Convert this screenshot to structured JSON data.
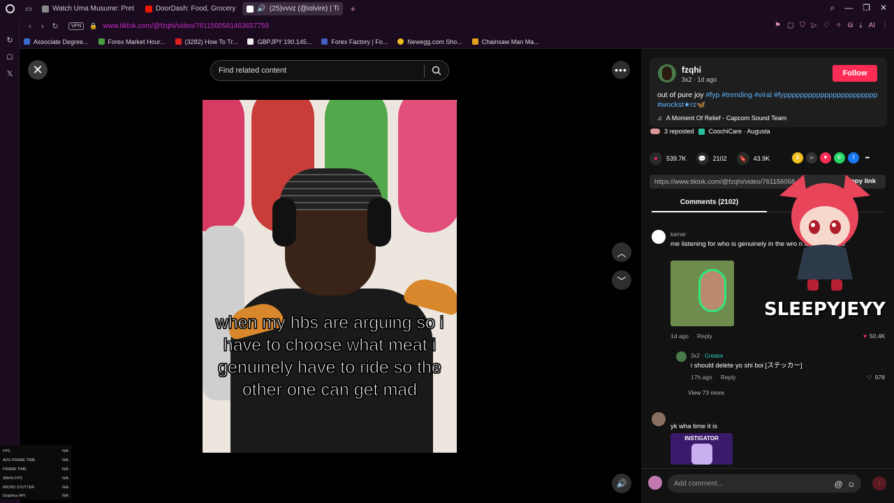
{
  "browser": {
    "tabs": [
      {
        "label": "Watch Uma Musume: Pret",
        "color": "#cccccc"
      },
      {
        "label": "DoorDash: Food, Grocery",
        "color": "#eb1700"
      },
      {
        "label": "(25)vvvz (@iolvire) | Ti",
        "color": "#ffffff",
        "active": true
      }
    ],
    "url": "www.tiktok.com/@fzqhi/video/7611560581463657759",
    "vpn_label": "VPN",
    "bookmarks": [
      {
        "label": "Associate Degree...",
        "color": "#3a6ad0"
      },
      {
        "label": "Forex Market Hour...",
        "color": "#48a040"
      },
      {
        "label": "(3282) How To Tr...",
        "color": "#e02020"
      },
      {
        "label": "GBPJPY 190.145...",
        "color": "#eeeeee"
      },
      {
        "label": "Forex Factory | Fo...",
        "color": "#4060c0"
      },
      {
        "label": "Newegg.com Sho...",
        "color": "#f0c020"
      },
      {
        "label": "Chainsaw Man Ma...",
        "color": "#e0a020"
      }
    ]
  },
  "search": {
    "placeholder": "Find related content"
  },
  "video": {
    "caption": "when my hbs are arguing so i have to choose what meat i genuinely have to ride so the other one can get mad"
  },
  "stats": [
    {
      "label": "FPS",
      "value": "N/A"
    },
    {
      "label": "AVG FRAME TIME",
      "value": "N/A"
    },
    {
      "label": "FRAME TIME",
      "value": "N/A"
    },
    {
      "label": "99th% FPS",
      "value": "N/A"
    },
    {
      "label": "MICRO STUTTER",
      "value": "N/A"
    },
    {
      "label": "Graphics API",
      "value": "N/A"
    }
  ],
  "post": {
    "username": "fzqhi",
    "meta": "3x2 · 1d ago",
    "follow_label": "Follow",
    "desc_text": "out of pure joy ",
    "tags": [
      "#fyp",
      "#trending",
      "#viral",
      "#fyppppppppppppppppppppppp",
      "#wockst★rz"
    ],
    "emoji": "🦋",
    "music": "A Moment Of Relief - Capcom Sound Team",
    "reposted": "3 reposted",
    "location": "CoochiCare · Augusta",
    "likes": "539.7K",
    "comments_count": "2102",
    "saves": "43.9K",
    "link": "https://www.tiktok.com/@fzqhi/video/761156058",
    "copy_link": "Copy link",
    "comments_tab": "Comments (2102)"
  },
  "comments": [
    {
      "name": "kamar",
      "text": "me listening for who is genuinely in the wro          n take they side",
      "time": "1d ago",
      "reply": "Reply",
      "likes": "50.4K"
    },
    {
      "name": "3x2",
      "creator": "· Creator",
      "text": "i should delete yo shi boi [ステッカー]",
      "time": "17h ago",
      "reply": "Reply",
      "likes": "978"
    },
    {
      "name": "",
      "text": "yk wha time it is",
      "image_label": "INSTIGATOR"
    }
  ],
  "view_more": "View 73 more",
  "comment_input": {
    "placeholder": "Add comment..."
  },
  "overlay": {
    "name": "SLEEPYJEYY"
  }
}
